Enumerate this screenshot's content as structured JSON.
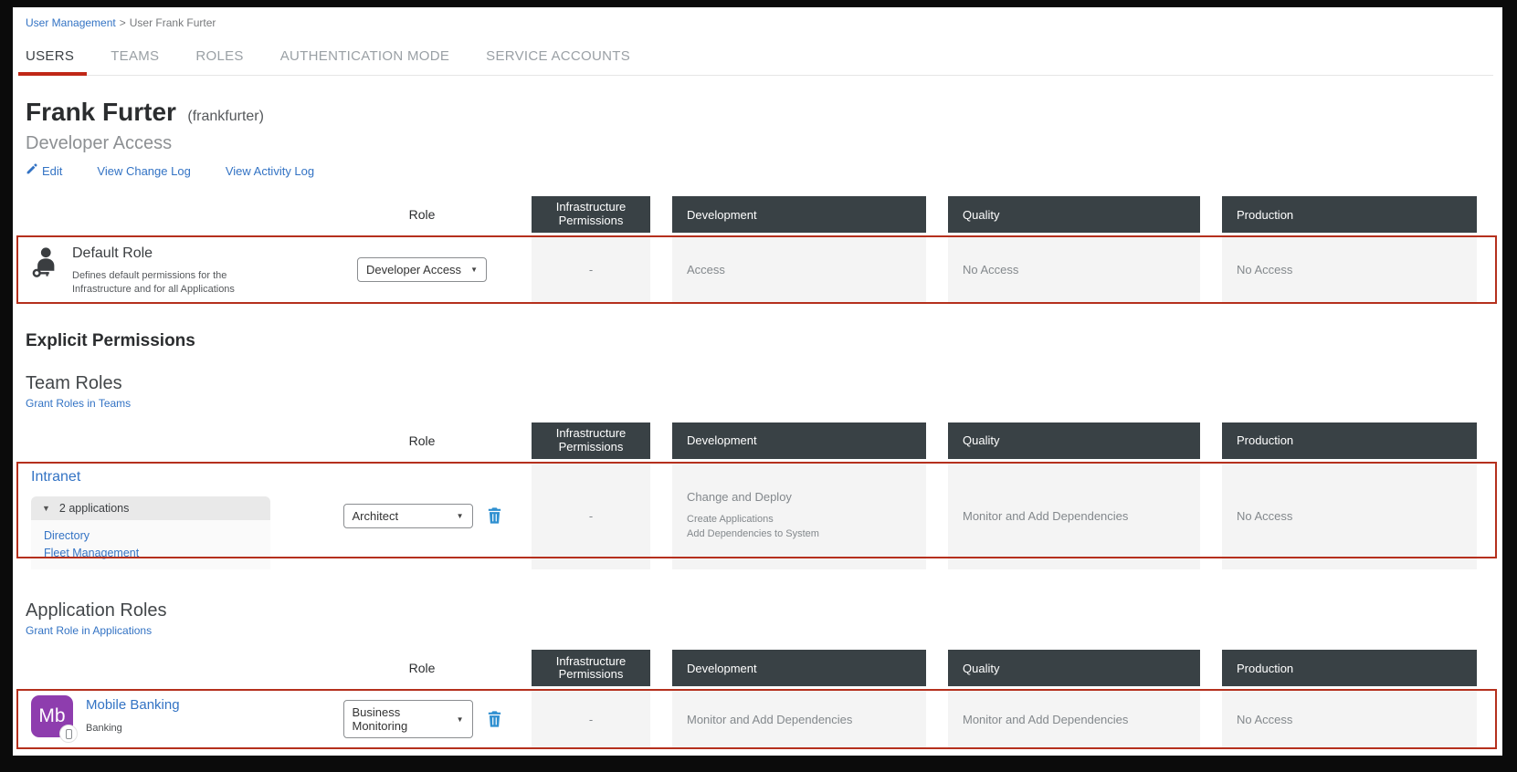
{
  "breadcrumb": {
    "parent": "User Management",
    "separator": ">",
    "current": "User Frank Furter"
  },
  "tabs": [
    {
      "label": "USERS",
      "active": true
    },
    {
      "label": "TEAMS",
      "active": false
    },
    {
      "label": "ROLES",
      "active": false
    },
    {
      "label": "AUTHENTICATION MODE",
      "active": false
    },
    {
      "label": "SERVICE ACCOUNTS",
      "active": false
    }
  ],
  "user": {
    "name": "Frank Furter",
    "username": "(frankfurter)",
    "access_level": "Developer Access",
    "edit_label": "Edit",
    "change_log_label": "View Change Log",
    "activity_log_label": "View Activity Log"
  },
  "columns": {
    "role": "Role",
    "infrastructure": "Infrastructure Permissions",
    "development": "Development",
    "quality": "Quality",
    "production": "Production"
  },
  "default_role": {
    "title": "Default Role",
    "description": "Defines default permissions for the Infrastructure and for all Applications",
    "selected_role": "Developer Access",
    "permissions": {
      "infrastructure": "-",
      "development": "Access",
      "quality": "No Access",
      "production": "No Access"
    }
  },
  "sections": {
    "explicit_permissions": "Explicit Permissions",
    "team_roles": {
      "title": "Team Roles",
      "grant_link": "Grant Roles in Teams"
    },
    "application_roles": {
      "title": "Application Roles",
      "grant_link": "Grant Role in Applications"
    }
  },
  "team_roles": [
    {
      "team": "Intranet",
      "applications_toggle": "2 applications",
      "applications": [
        {
          "name": "Directory"
        },
        {
          "name": "Fleet Management"
        }
      ],
      "selected_role": "Architect",
      "permissions": {
        "infrastructure": "-",
        "development": "Change and Deploy",
        "development_details": [
          {
            "text": "Create Applications"
          },
          {
            "text": "Add Dependencies to System"
          }
        ],
        "quality": "Monitor and Add Dependencies",
        "production": "No Access"
      }
    }
  ],
  "application_roles": [
    {
      "application": "Mobile Banking",
      "team": "Banking",
      "avatar_initials": "Mb",
      "selected_role": "Business Monitoring",
      "permissions": {
        "infrastructure": "-",
        "development": "Monitor and Add Dependencies",
        "quality": "Monitor and Add Dependencies",
        "production": "No Access"
      }
    }
  ],
  "icons": {
    "chevron_down": "▼",
    "expander_triangle": "▼"
  },
  "colors": {
    "accent_red": "#b5301d",
    "tab_red": "#c02717",
    "header_dark": "#394145",
    "link_blue": "#3373c4",
    "cell_bg": "#f4f4f4",
    "avatar_purple": "#8e3dae",
    "trash_blue": "#2e8fd0"
  }
}
